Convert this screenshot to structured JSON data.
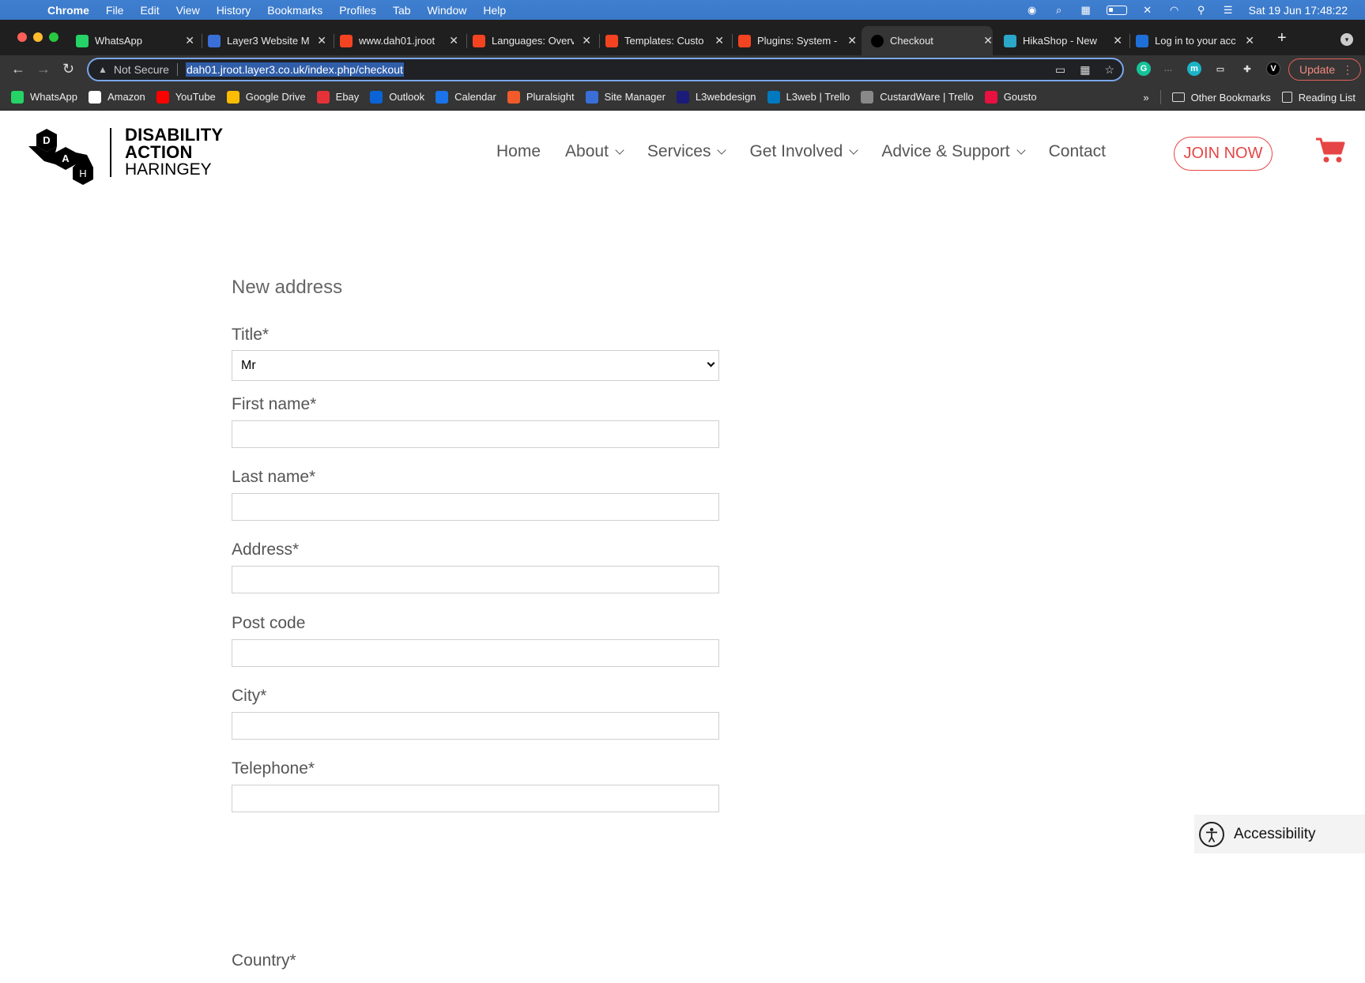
{
  "menubar": {
    "app": "Chrome",
    "items": [
      "File",
      "Edit",
      "View",
      "History",
      "Bookmarks",
      "Profiles",
      "Tab",
      "Window",
      "Help"
    ],
    "clock": "Sat 19 Jun  17:48:22"
  },
  "tabs": [
    {
      "title": "WhatsApp",
      "icon": "whatsapp-icon",
      "color": "#25d366"
    },
    {
      "title": "Layer3 Website M",
      "icon": "layer3-icon",
      "color": "#3a6fd8"
    },
    {
      "title": "www.dah01.jroot",
      "icon": "joomla-icon",
      "color": "#f44321"
    },
    {
      "title": "Languages: Overv",
      "icon": "joomla-icon",
      "color": "#f44321"
    },
    {
      "title": "Templates: Custo",
      "icon": "joomla-icon",
      "color": "#f44321"
    },
    {
      "title": "Plugins: System -",
      "icon": "joomla-icon",
      "color": "#f44321"
    },
    {
      "title": "Checkout",
      "icon": "circle-icon",
      "color": "#000000",
      "active": true
    },
    {
      "title": "HikaShop - New",
      "icon": "hikashop-icon",
      "color": "#2aa7c9"
    },
    {
      "title": "Log in to your acc",
      "icon": "paypal-icon",
      "color": "#1f6fd8"
    }
  ],
  "toolbar": {
    "security": "Not Secure",
    "url": "dah01.jroot.layer3.co.uk/index.php/checkout",
    "update_label": "Update"
  },
  "bookmarks": [
    {
      "label": "WhatsApp",
      "color": "#25d366"
    },
    {
      "label": "Amazon",
      "color": "#ffffff"
    },
    {
      "label": "YouTube",
      "color": "#ff0000"
    },
    {
      "label": "Google Drive",
      "color": "#fbbc04"
    },
    {
      "label": "Ebay",
      "color": "#e53238"
    },
    {
      "label": "Outlook",
      "color": "#0a64d6"
    },
    {
      "label": "Calendar",
      "color": "#1a73e8"
    },
    {
      "label": "Pluralsight",
      "color": "#f15b2a"
    },
    {
      "label": "Site Manager",
      "color": "#3a6fd8"
    },
    {
      "label": "L3webdesign",
      "color": "#1b1b7a"
    },
    {
      "label": "L3web | Trello",
      "color": "#0079bf"
    },
    {
      "label": "CustardWare | Trello",
      "color": "#888888"
    },
    {
      "label": "Gousto",
      "color": "#e8113f"
    }
  ],
  "bookmarks_overflow": "»",
  "bookmarks_other": "Other Bookmarks",
  "bookmarks_reading": "Reading List",
  "site": {
    "logo_line1": "DISABILITY",
    "logo_line2": "ACTION",
    "logo_line3": "HARINGEY",
    "logo_letters": [
      "D",
      "A",
      "H"
    ],
    "nav": [
      {
        "label": "Home",
        "has_dropdown": false
      },
      {
        "label": "About",
        "has_dropdown": true
      },
      {
        "label": "Services",
        "has_dropdown": true
      },
      {
        "label": "Get Involved",
        "has_dropdown": true
      },
      {
        "label": "Advice & Support",
        "has_dropdown": true
      },
      {
        "label": "Contact",
        "has_dropdown": false
      }
    ],
    "join_label": "JOIN NOW",
    "accent": "#e64545"
  },
  "form": {
    "heading": "New address",
    "title_label": "Title*",
    "title_value": "Mr",
    "fields": [
      {
        "label": "First name*",
        "value": ""
      },
      {
        "label": "Last name*",
        "value": ""
      },
      {
        "label": "Address*",
        "value": ""
      },
      {
        "label": "Post code",
        "value": ""
      },
      {
        "label": "City*",
        "value": ""
      },
      {
        "label": "Telephone*",
        "value": ""
      }
    ],
    "cut_label": "Country*"
  },
  "accessibility": {
    "label": "Accessibility"
  }
}
